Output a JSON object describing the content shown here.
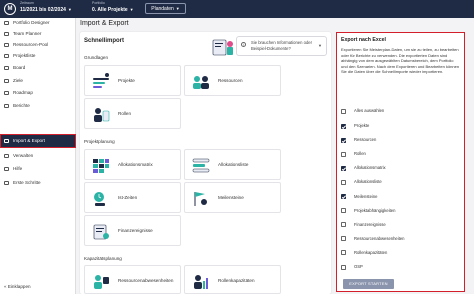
{
  "topbar": {
    "logo_letter": "M",
    "period_label": "Zeitraum",
    "period_value": "11/2021 bis 02/2024",
    "portfolio_label": "Portfolio",
    "portfolio_value": "0. Alle Projekte",
    "plan_value": "Plandaten"
  },
  "sidebar": {
    "items": [
      {
        "label": "Portfolio Designer",
        "icon": "grid-icon"
      },
      {
        "label": "Team Planner",
        "icon": "team-icon"
      },
      {
        "label": "Ressourcen-Pool",
        "icon": "people-icon"
      },
      {
        "label": "Projektliste",
        "icon": "list-icon"
      },
      {
        "label": "Board",
        "icon": "board-icon"
      },
      {
        "label": "Ziele",
        "icon": "target-icon"
      },
      {
        "label": "Roadmap",
        "icon": "roadmap-icon"
      },
      {
        "label": "Berichte",
        "icon": "report-icon"
      },
      {
        "label": "Import & Export",
        "icon": "import-export-icon"
      },
      {
        "label": "Verwalten",
        "icon": "settings-icon"
      },
      {
        "label": "Hilfe",
        "icon": "help-icon"
      },
      {
        "label": "Erste Schritte",
        "icon": "rocket-icon"
      }
    ],
    "collapse_label": "Einklappen"
  },
  "main": {
    "title": "Import & Export",
    "card_title": "Schnellimport",
    "help_text": "Sie brauchen Informationen oder Beispiel-Dokumente?",
    "sections": {
      "basics": "Grundlagen",
      "project_planning": "Projektplanung",
      "capacity_planning": "Kapazitätsplanung"
    },
    "tiles": {
      "projekte": "Projekte",
      "ressourcen": "Ressourcen",
      "rollen": "Rollen",
      "allokationsmatrix": "Allokationsmatrix",
      "allokationsliste": "Allokationsliste",
      "ist_zeiten": "Ist-Zeiten",
      "meilensteine": "Meilensteine",
      "finanzereignisse": "Finanzereignisse",
      "ressourcenabwesenheiten": "Ressourcenabwesenheiten",
      "rollenkapazitaeten": "Rollenkapazitäten"
    }
  },
  "export_panel": {
    "title": "Export nach Excel",
    "description": "Exportieren Sie Meisterplan-Daten, um sie zu teilen, zu bearbeiten oder für Berichte zu verwenden. Die exportierten Daten sind abhängig von dem ausgewählten Datumsbereich, dem Portfolio und den Szenarien. Nach dem Exportieren und Bearbeiten können Sie die Daten über die Schnellimporte wieder importieren.",
    "select_all": "Alles auswählen",
    "options": [
      {
        "label": "Projekte",
        "checked": true
      },
      {
        "label": "Ressourcen",
        "checked": true
      },
      {
        "label": "Rollen",
        "checked": false
      },
      {
        "label": "Allokationsmatrix",
        "checked": true
      },
      {
        "label": "Allokationsliste",
        "checked": false
      },
      {
        "label": "Meilensteine",
        "checked": true
      },
      {
        "label": "Projektabhängigkeiten",
        "checked": false
      },
      {
        "label": "Finanzereignisse",
        "checked": false
      },
      {
        "label": "Ressourcenabwesenheiten",
        "checked": false
      },
      {
        "label": "Rollenkapazitäten",
        "checked": false
      },
      {
        "label": "OSP",
        "checked": false
      }
    ],
    "export_button": "EXPORT STARTEN"
  },
  "colors": {
    "navy": "#1f2a44",
    "highlight_red": "#d21f2b",
    "teal": "#2bb3a6",
    "purple": "#6b5bd6"
  }
}
